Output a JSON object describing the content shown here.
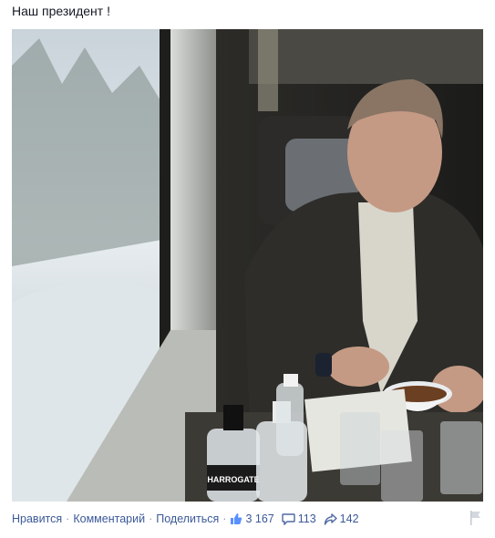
{
  "post": {
    "caption": "Наш президент !",
    "photo": {
      "description_icon": "photo-image",
      "bottle_label": "HARROGATE SPA"
    }
  },
  "actions": {
    "like_label": "Нравится",
    "comment_label": "Комментарий",
    "share_label": "Поделиться",
    "separator": "·"
  },
  "stats": {
    "likes": "3 167",
    "comments": "113",
    "shares": "142"
  },
  "icons": {
    "like": "thumbs-up-icon",
    "comment": "comment-bubble-icon",
    "share": "share-arrow-icon",
    "report": "flag-icon"
  },
  "colors": {
    "link": "#3b5998",
    "text": "#141823",
    "muted": "#9197a3"
  }
}
